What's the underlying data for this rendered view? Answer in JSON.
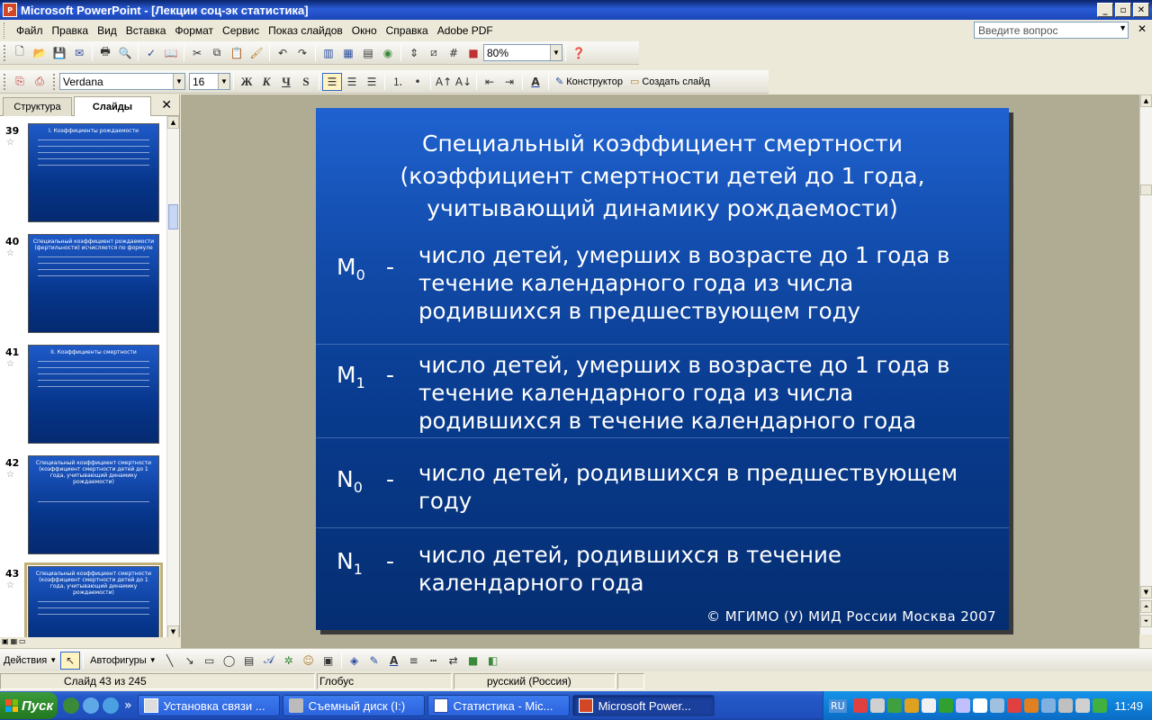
{
  "window": {
    "title": "Microsoft PowerPoint - [Лекции соц-эк статистика]",
    "app_icon_text": "P",
    "btn_min": "_",
    "btn_max": "▫",
    "btn_close": "✕"
  },
  "menu": {
    "items": [
      "Файл",
      "Правка",
      "Вид",
      "Вставка",
      "Формат",
      "Сервис",
      "Показ слайдов",
      "Окно",
      "Справка",
      "Adobe PDF"
    ],
    "help_placeholder": "Введите вопрос",
    "doc_close": "✕"
  },
  "standard_toolbar": {
    "zoom": "80%"
  },
  "format_toolbar": {
    "font_name": "Verdana",
    "font_size": "16",
    "bold": "Ж",
    "italic": "К",
    "underline": "Ч",
    "shadow": "S",
    "designer": "Конструктор",
    "new_slide": "Создать слайд"
  },
  "left_pane": {
    "tabs": [
      "Структура",
      "Слайды"
    ],
    "active_tab": "Слайды",
    "close": "✕",
    "thumbnails": [
      {
        "number": "39",
        "title": "I. Коэффициенты рождаемости",
        "selected": false
      },
      {
        "number": "40",
        "title": "Специальный коэффициент рождаемости (фертильности) исчисляется по формуле",
        "selected": false
      },
      {
        "number": "41",
        "title": "II. Коэффициенты смертности",
        "selected": false
      },
      {
        "number": "42",
        "title": "Специальный коэффициент смертности (коэффициент смертности детей до 1 года, учитывающий динамику рождаемости)",
        "selected": false
      },
      {
        "number": "43",
        "title": "Специальный коэффициент смертности (коэффициент смертности детей до 1 года, учитывающий динамику рождаемости)",
        "selected": true
      }
    ]
  },
  "slide": {
    "title_lines": [
      "Специальный коэффициент смертности",
      "(коэффициент смертности детей до 1 года,",
      "учитывающий динамику рождаемости)"
    ],
    "definitions": [
      {
        "symbol": "M",
        "sub": "0",
        "dash": "-",
        "text": "число детей, умерших в возрасте до 1 года в течение календарного года из числа родившихся в предшествующем году"
      },
      {
        "symbol": "M",
        "sub": "1",
        "dash": "-",
        "text": "число детей, умерших в возрасте до 1 года в течение календарного года из числа родившихся в течение календарного года"
      },
      {
        "symbol": "N",
        "sub": "0",
        "dash": "-",
        "text": "число детей, родившихся в предшествующем году"
      },
      {
        "symbol": "N",
        "sub": "1",
        "dash": "-",
        "text": "число детей, родившихся в течение календарного года"
      }
    ],
    "copyright": "© МГИМО (У) МИД России Москва 2007"
  },
  "draw_toolbar": {
    "actions": "Действия",
    "autoshapes": "Автофигуры"
  },
  "status_bar": {
    "slide_info": "Слайд 43 из 245",
    "design": "Глобус",
    "language": "русский (Россия)"
  },
  "taskbar": {
    "start": "Пуск",
    "chevron": "»",
    "tasks": [
      {
        "label": "Установка связи ...",
        "active": false
      },
      {
        "label": "Съемный диск (I:)",
        "active": false
      },
      {
        "label": "Статистика - Mic...",
        "active": false
      },
      {
        "label": "Microsoft Power...",
        "active": true
      }
    ],
    "lang": "RU",
    "clock": "11:49"
  },
  "colors": {
    "slide_top": "#1f62d0",
    "slide_bottom": "#052e72",
    "taskbar": "#2457c7",
    "tray": "#0f7fd8"
  }
}
